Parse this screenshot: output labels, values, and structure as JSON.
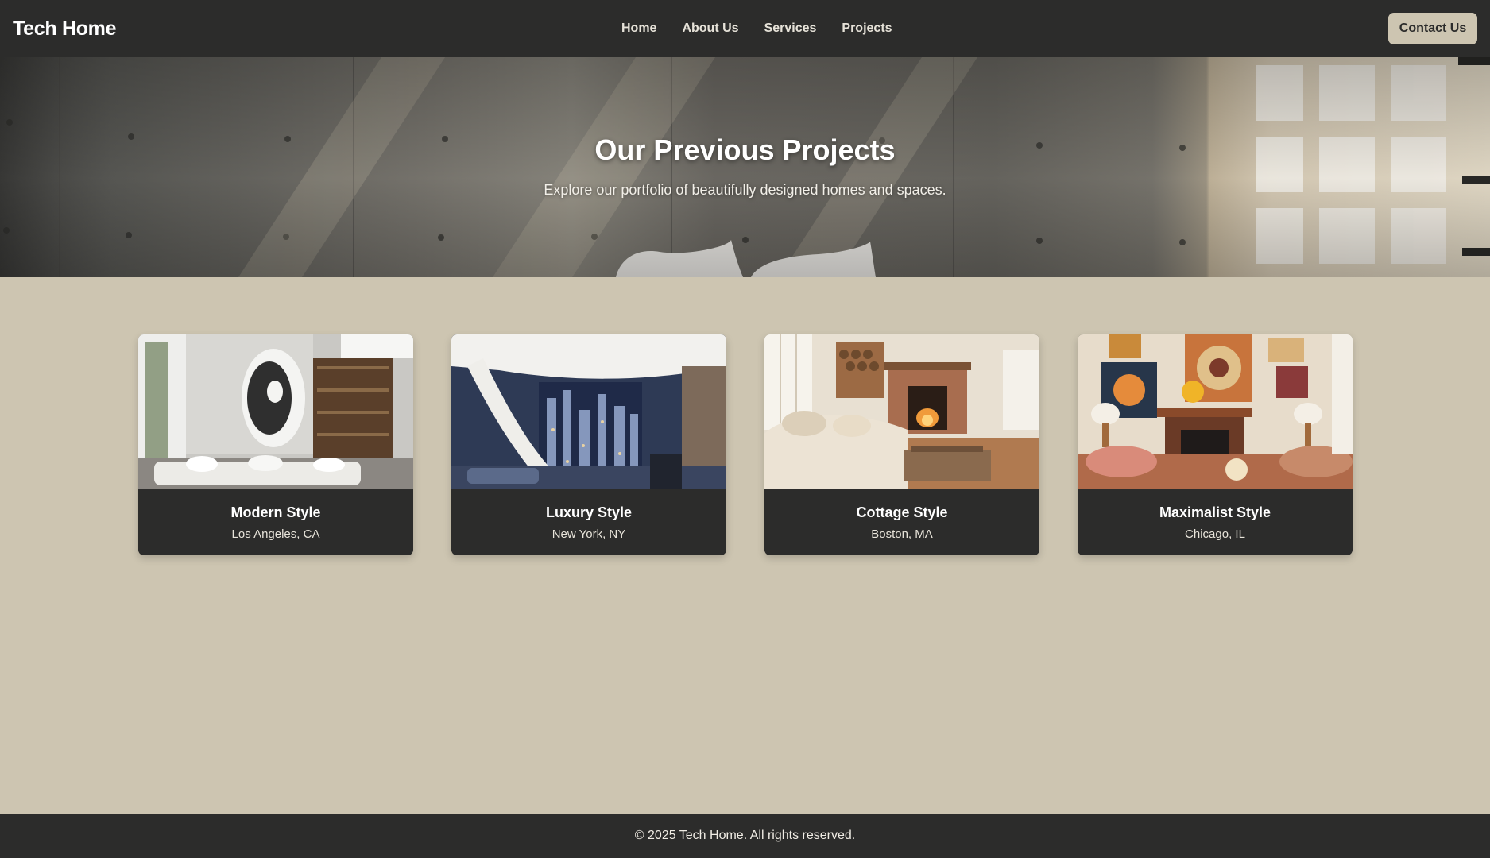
{
  "brand": {
    "name": "Tech Home"
  },
  "nav": {
    "links": [
      {
        "label": "Home"
      },
      {
        "label": "About Us"
      },
      {
        "label": "Services"
      },
      {
        "label": "Projects"
      }
    ],
    "contact_label": "Contact Us"
  },
  "hero": {
    "title": "Our Previous Projects",
    "subtitle": "Explore our portfolio of beautifully designed homes and spaces.",
    "image": "concrete-wall-interior-with-window-light"
  },
  "projects": [
    {
      "title": "Modern Style",
      "location": "Los Angeles, CA",
      "image": "modern-living-room"
    },
    {
      "title": "Luxury Style",
      "location": "New York, NY",
      "image": "luxury-penthouse-staircase"
    },
    {
      "title": "Cottage Style",
      "location": "Boston, MA",
      "image": "cottage-living-room-fireplace"
    },
    {
      "title": "Maximalist Style",
      "location": "Chicago, IL",
      "image": "maximalist-living-room-art-wall"
    }
  ],
  "footer": {
    "text": "© 2025 Tech Home. All rights reserved."
  },
  "colors": {
    "nav_background": "#2c2c2b",
    "page_background": "#cdc5b1",
    "card_background": "#2c2c2b",
    "button_background": "#cdc5b1"
  }
}
